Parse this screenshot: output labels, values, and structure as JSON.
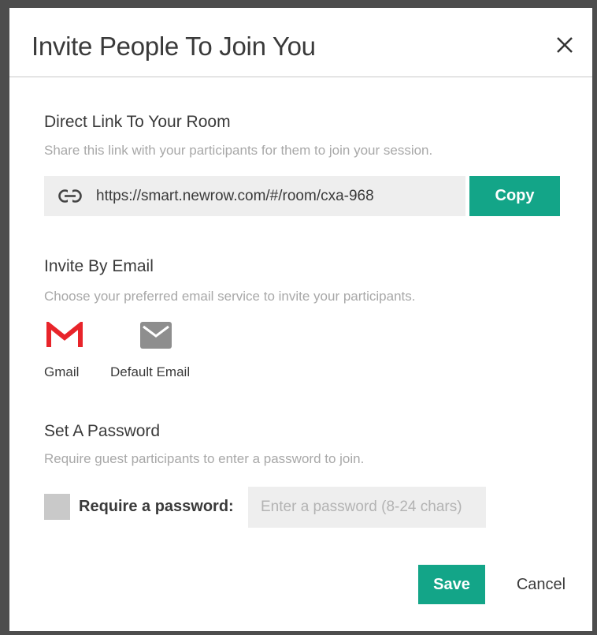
{
  "dialog": {
    "title": "Invite People To Join You",
    "close_icon": "close-icon"
  },
  "direct_link": {
    "title": "Direct Link To Your Room",
    "description": "Share this link with your participants for them to join your session.",
    "url": "https://smart.newrow.com/#/room/cxa-968",
    "link_icon": "link-icon",
    "copy_label": "Copy"
  },
  "invite_email": {
    "title": "Invite By Email",
    "description": "Choose your preferred email service to invite your participants.",
    "options": [
      {
        "label": "Gmail",
        "icon": "gmail-icon",
        "color": "#e8242a"
      },
      {
        "label": "Default Email",
        "icon": "envelope-icon",
        "color": "#8e8e8e"
      }
    ]
  },
  "password": {
    "title": "Set A Password",
    "description": "Require guest participants to enter a password to join.",
    "checkbox_label": "Require a password:",
    "checked": false,
    "input_value": "",
    "input_placeholder": "Enter a password (8-24 chars)"
  },
  "footer": {
    "save_label": "Save",
    "cancel_label": "Cancel"
  },
  "colors": {
    "accent": "#13a588",
    "backdrop": "#4d4d4d"
  }
}
